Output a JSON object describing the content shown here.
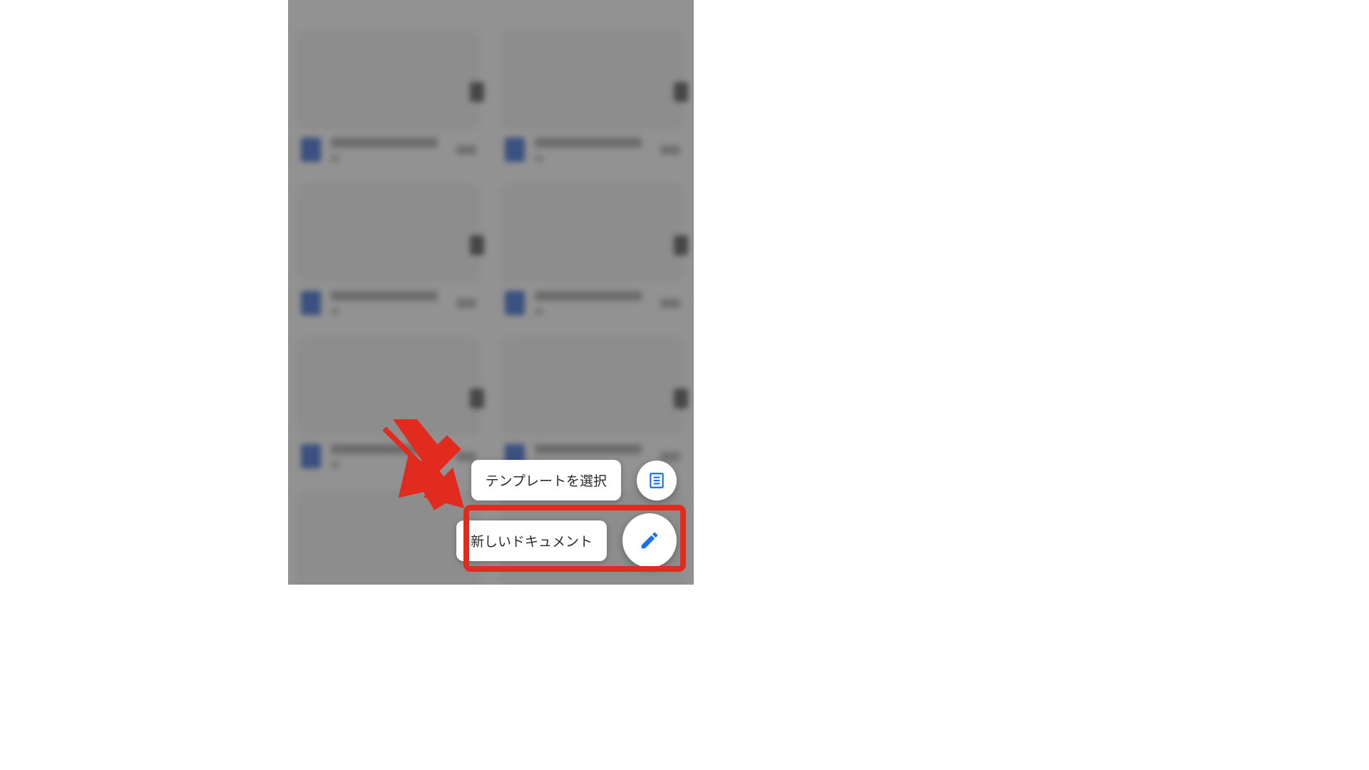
{
  "fab_menu": {
    "choose_template": "テンプレートを選択",
    "new_document": "新しいドキュメント"
  },
  "icons": {
    "template": "template-icon",
    "edit": "pencil-icon"
  },
  "colors": {
    "accent": "#1a73e8",
    "highlight": "#e22b1f"
  }
}
